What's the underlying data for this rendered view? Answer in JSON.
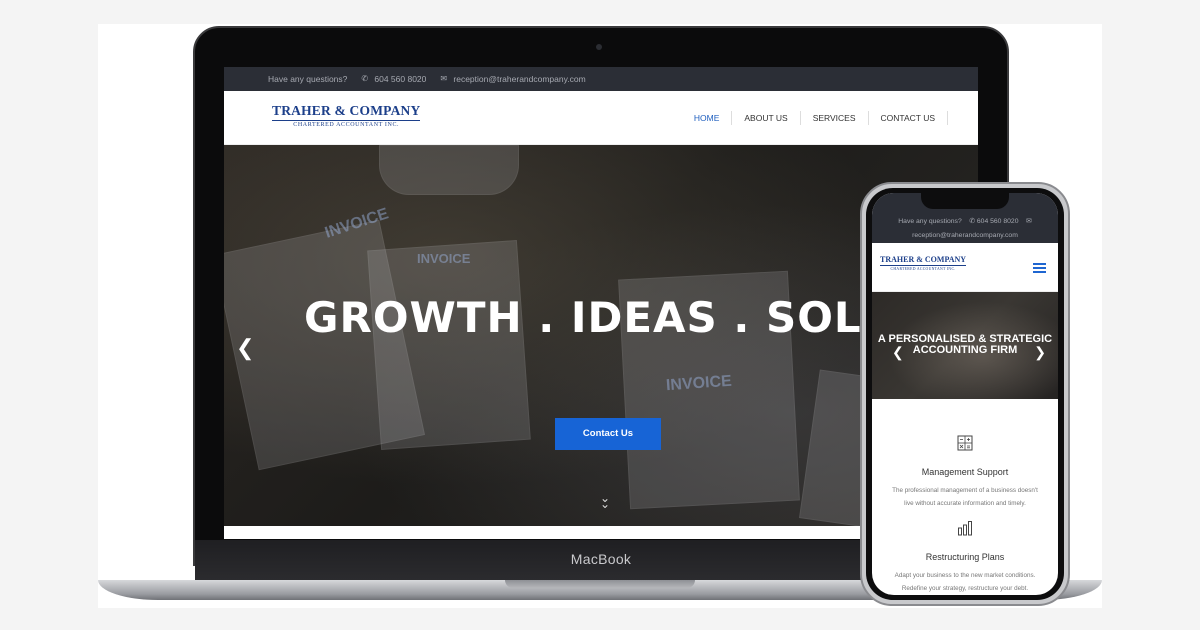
{
  "desktop": {
    "device_label": "MacBook",
    "topbar": {
      "question": "Have any questions?",
      "phone": "604 560 8020",
      "email": "reception@traherandcompany.com"
    },
    "logo": {
      "name": "TRAHER & COMPANY",
      "tagline": "CHARTERED ACCOUNTANT INC."
    },
    "nav": [
      {
        "label": "HOME",
        "active": true
      },
      {
        "label": "ABOUT US",
        "active": false
      },
      {
        "label": "SERVICES",
        "active": false
      },
      {
        "label": "CONTACT US",
        "active": false
      }
    ],
    "hero": {
      "title": "GROWTH . IDEAS . SOLUTIONS",
      "cta": "Contact Us",
      "invoice_labels": [
        "INVOICE",
        "INVOICE",
        "INVOICE"
      ]
    }
  },
  "mobile": {
    "topbar": {
      "question": "Have any questions?",
      "phone": "604 560 8020",
      "email": "reception@traherandcompany.com"
    },
    "logo": {
      "name": "TRAHER & COMPANY",
      "tagline": "CHARTERED ACCOUNTANT INC."
    },
    "hero": {
      "title_line1": "A PERSONALISED & STRATEGIC",
      "title_line2": "ACCOUNTING FIRM"
    },
    "services": [
      {
        "icon": "calculator-icon",
        "title": "Management Support",
        "desc_line1": "The professional management of a business doesn't",
        "desc_line2": "live without accurate information and timely."
      },
      {
        "icon": "bar-chart-icon",
        "title": "Restructuring Plans",
        "desc_line1": "Adapt your business to the new market conditions.",
        "desc_line2": "Redefine your strategy, restructure your debt."
      }
    ]
  },
  "colors": {
    "accent": "#1764d6",
    "logo_blue": "#1c3f8a",
    "topbar": "#2b2e36"
  }
}
